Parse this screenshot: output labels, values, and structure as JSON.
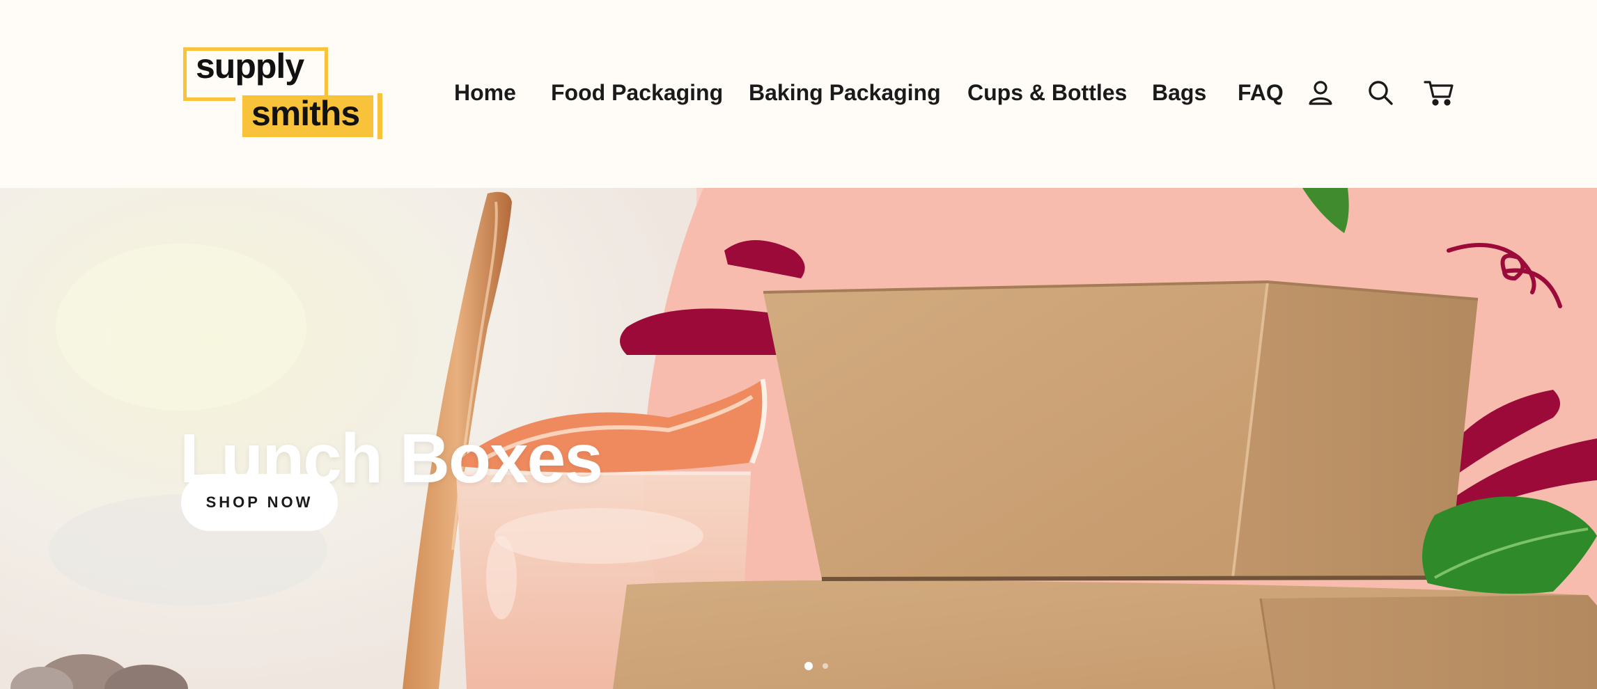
{
  "header": {
    "logo": {
      "line1": "supply",
      "line2": "smiths",
      "accent_color": "#f8c33a"
    },
    "nav": [
      {
        "label": "Home"
      },
      {
        "label": "Food Packaging"
      },
      {
        "label": "Baking Packaging"
      },
      {
        "label": "Cups & Bottles"
      },
      {
        "label": "Bags"
      },
      {
        "label": "FAQ"
      }
    ],
    "icons": [
      "account-icon",
      "search-icon",
      "cart-icon"
    ]
  },
  "hero": {
    "title": "Lunch Boxes",
    "cta_label": "SHOP NOW",
    "slides_total": 2,
    "active_slide": 1,
    "colors": {
      "pink_background": "#f8bcae",
      "splash": "#9c0a3a",
      "kraft": "#c9a074",
      "leaf": "#2f8a2a"
    }
  }
}
